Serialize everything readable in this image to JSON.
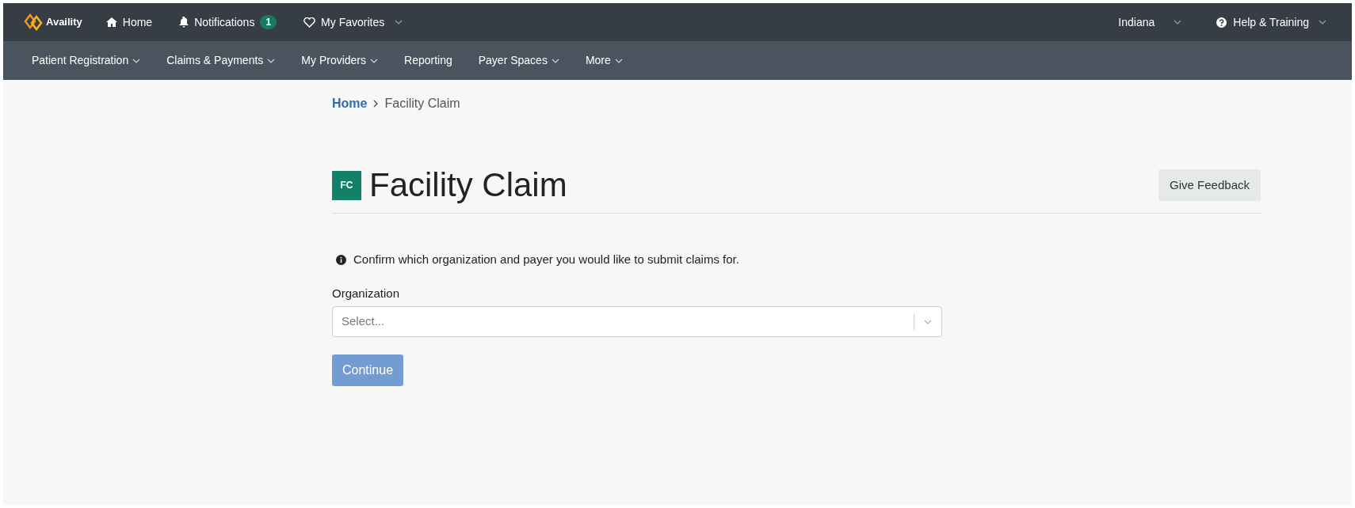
{
  "top_nav": {
    "brand": "Availity",
    "items": [
      {
        "kind": "home",
        "label": "Home"
      },
      {
        "kind": "notifications",
        "label": "Notifications",
        "badge": "1"
      },
      {
        "kind": "favorites",
        "label": "My Favorites"
      }
    ],
    "region": "Indiana",
    "help": "Help & Training"
  },
  "menu": [
    {
      "label": "Patient Registration",
      "dropdown": true
    },
    {
      "label": "Claims & Payments",
      "dropdown": true
    },
    {
      "label": "My Providers",
      "dropdown": true
    },
    {
      "label": "Reporting",
      "dropdown": false
    },
    {
      "label": "Payer Spaces",
      "dropdown": true
    },
    {
      "label": "More",
      "dropdown": true
    }
  ],
  "breadcrumb": [
    {
      "label": "Home",
      "link": true
    },
    {
      "label": "Facility Claim",
      "link": false
    }
  ],
  "page": {
    "badge": "FC",
    "title": "Facility Claim",
    "feedback_button": "Give Feedback",
    "info": "Confirm which organization and payer you would like to submit claims for.",
    "field_label": "Organization",
    "field_placeholder": "Select...",
    "continue_button": {
      "label": "Continue",
      "disabled": true
    }
  }
}
